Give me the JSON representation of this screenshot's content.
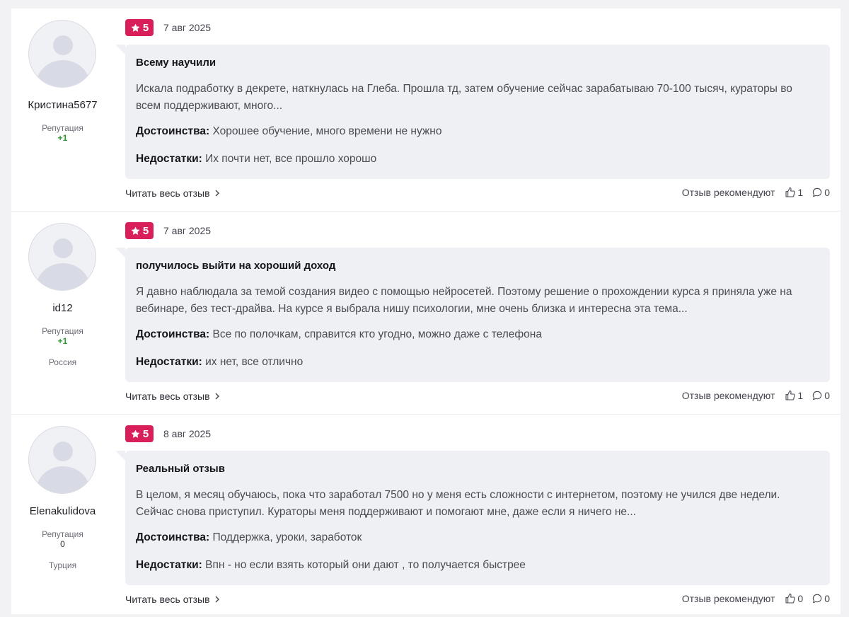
{
  "colors": {
    "page_background": "#f2f2f5",
    "rating_badge": "#d81f5a",
    "reputation_positive": "#2e9b2e",
    "content_background": "#eff0f3"
  },
  "labels": {
    "reputation": "Репутация",
    "pros": "Достоинства:",
    "cons": "Недостатки:",
    "read_more": "Читать весь отзыв",
    "recommend": "Отзыв рекомендуют"
  },
  "reviews": [
    {
      "author": "Кристина5677",
      "reputation": "+1",
      "country": "",
      "rating": "5",
      "date": "7 авг 2025",
      "title": "Всему научили",
      "text": "Искала подработку в декрете, наткнулась на Глеба. Прошла тд, затем обучение сейчас зарабатываю 70-100 тысяч, кураторы во всем поддерживают, много...",
      "pros": "Хорошее обучение, много времени не нужно",
      "cons": "Их почти нет, все прошло хорошо",
      "likes": "1",
      "comments": "0"
    },
    {
      "author": "id12",
      "reputation": "+1",
      "country": "Россия",
      "rating": "5",
      "date": "7 авг 2025",
      "title": "получилось выйти на хороший доход",
      "text": "Я давно наблюдала за темой создания видео с помощью нейросетей. Поэтому решение о прохождении курса я приняла уже на вебинаре, без тест-драйва. На курсе я выбрала нишу психологии, мне очень близка и интересна эта тема...",
      "pros": "Все по полочкам, справится кто угодно, можно даже с телефона",
      "cons": "их нет, все отлично",
      "likes": "1",
      "comments": "0"
    },
    {
      "author": "Elenakulidova",
      "reputation": "0",
      "country": "Турция",
      "rating": "5",
      "date": "8 авг 2025",
      "title": "Реальный отзыв",
      "text": "В целом, я месяц обучаюсь, пока что заработал 7500 но у меня есть сложности с интернетом, поэтому не учился две недели. Сейчас снова приступил. Кураторы меня поддерживают и помогают мне, даже если я ничего не...",
      "pros": "Поддержка, уроки, заработок",
      "cons": "Впн - но если взять который они дают , то получается быстрее",
      "likes": "0",
      "comments": "0"
    }
  ]
}
